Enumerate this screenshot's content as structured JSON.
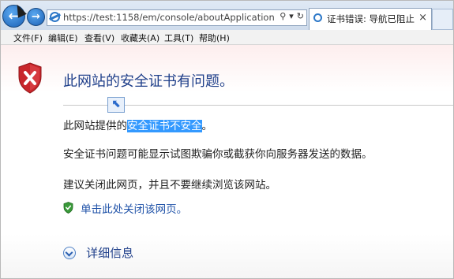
{
  "browser": {
    "address_url": "https://test:1158/em/console/aboutApplication",
    "address_icons": [
      "search-icon",
      "dropdown-icon",
      "refresh-icon"
    ],
    "tab_title": "证书错误: 导航已阻止",
    "tab_close": "×"
  },
  "menu": {
    "items": [
      {
        "label": "文件(F)"
      },
      {
        "label": "编辑(E)"
      },
      {
        "label": "查看(V)"
      },
      {
        "label": "收藏夹(A)"
      },
      {
        "label": "工具(T)"
      },
      {
        "label": "帮助(H)"
      }
    ]
  },
  "page": {
    "heading": "此网站的安全证书有问题。",
    "p1_prefix": "此网站提供的",
    "p1_highlight": "安全证书不安全",
    "p1_suffix": "。",
    "p2": "安全证书问题可能显示试图欺骗你或截获你向服务器发送的数据。",
    "p3": "建议关闭此网页，并且不要继续浏览该网站。",
    "close_link": "单击此处关闭该网页。",
    "details": "详细信息"
  },
  "colors": {
    "heading": "#1f3f8a",
    "link": "#1f52a8",
    "highlight": "#3399ff",
    "shield_red": "#c8262b",
    "shield_green": "#3a9a3a"
  }
}
